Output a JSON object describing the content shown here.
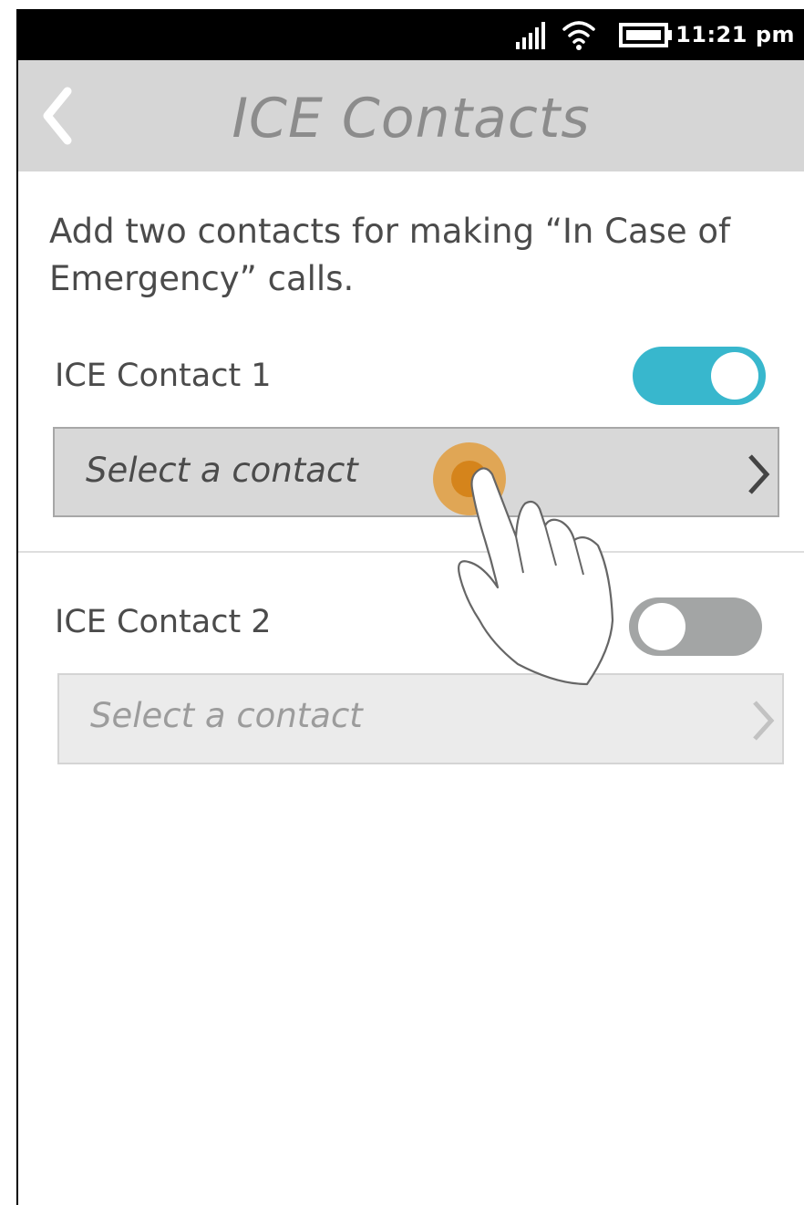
{
  "status_bar": {
    "time": "11:21 pm",
    "icons": [
      "signal-icon",
      "wifi-icon",
      "battery-icon"
    ]
  },
  "app_bar": {
    "back_icon": "chevron-left-icon",
    "title": "ICE Contacts"
  },
  "intro_text": "Add two contacts for making “In Case of Emergency” calls.",
  "contacts": [
    {
      "label": "ICE Contact 1",
      "toggle_on": true,
      "select_placeholder": "Select a contact",
      "enabled": true
    },
    {
      "label": "ICE Contact 2",
      "toggle_on": false,
      "select_placeholder": "Select a contact",
      "enabled": false
    }
  ],
  "colors": {
    "toggle_on": "#38b7cd",
    "toggle_off": "#a3a5a5",
    "app_bar_bg": "#d6d6d6",
    "tap_indicator": "#e3952a"
  }
}
